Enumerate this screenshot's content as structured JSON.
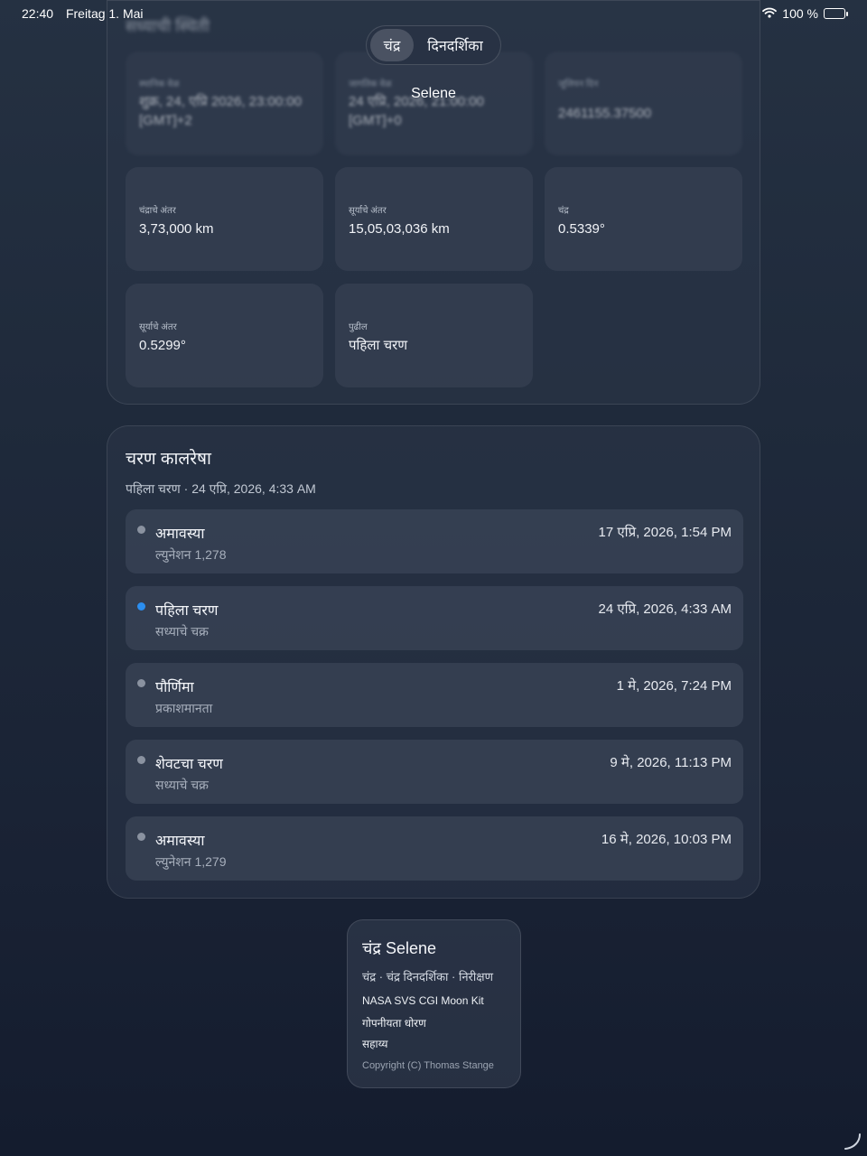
{
  "status": {
    "time": "22:40",
    "date": "Freitag 1. Mai",
    "battery": "100 %"
  },
  "nav": {
    "tabs": [
      {
        "label": "चंद्र",
        "active": true
      },
      {
        "label": "दिनदर्शिका",
        "active": false
      }
    ],
    "title": "Selene"
  },
  "info": {
    "heading": "सध्याची स्थिती",
    "tiles": [
      {
        "label": "स्थानिक वेळ",
        "value": "शुक्र, 24, एप्रि 2026, 23:00:00 [GMT]+2"
      },
      {
        "label": "जागतिक वेळ",
        "value": "24 एप्रि, 2026, 21:00:00 [GMT]+0"
      },
      {
        "label": "जूलियन दिन",
        "value": "2461155.37500"
      },
      {
        "label": "चंद्राचे अंतर",
        "value": "3,73,000 km"
      },
      {
        "label": "सूर्याचे अंतर",
        "value": "15,05,03,036 km"
      },
      {
        "label": "चंद्र",
        "value": "0.5339°"
      },
      {
        "label": "सूर्याचे अंतर",
        "value": "0.5299°"
      },
      {
        "label": "पुढील",
        "value": "पहिला चरण"
      }
    ]
  },
  "timeline": {
    "title": "चरण कालरेषा",
    "subtitle": "पहिला चरण · 24 एप्रि, 2026, 4:33 AM",
    "rows": [
      {
        "name": "अमावस्या",
        "detail": "ल्युनेशन 1,278",
        "date": "17 एप्रि, 2026, 1:54 PM",
        "current": false
      },
      {
        "name": "पहिला चरण",
        "detail": "सध्याचे चक्र",
        "date": "24 एप्रि, 2026, 4:33 AM",
        "current": true
      },
      {
        "name": "पौर्णिमा",
        "detail": "प्रकाशमानता",
        "date": "1 मे, 2026, 7:24 PM",
        "current": false
      },
      {
        "name": "शेवटचा चरण",
        "detail": "सध्याचे चक्र",
        "date": "9 मे, 2026, 11:13 PM",
        "current": false
      },
      {
        "name": "अमावस्या",
        "detail": "ल्युनेशन 1,279",
        "date": "16 मे, 2026, 10:03 PM",
        "current": false
      }
    ]
  },
  "footer": {
    "title": "चंद्र Selene",
    "links": "चंद्र · चंद्र दिनदर्शिका · निरीक्षण",
    "credit": "NASA SVS CGI Moon Kit",
    "privacy": "गोपनीयता धोरण",
    "help": "सहाय्य",
    "copyright": "Copyright (C) Thomas Stange"
  },
  "colors": {
    "current_dot": "#2b8ef0",
    "inactive_dot": "#8a92a0"
  }
}
